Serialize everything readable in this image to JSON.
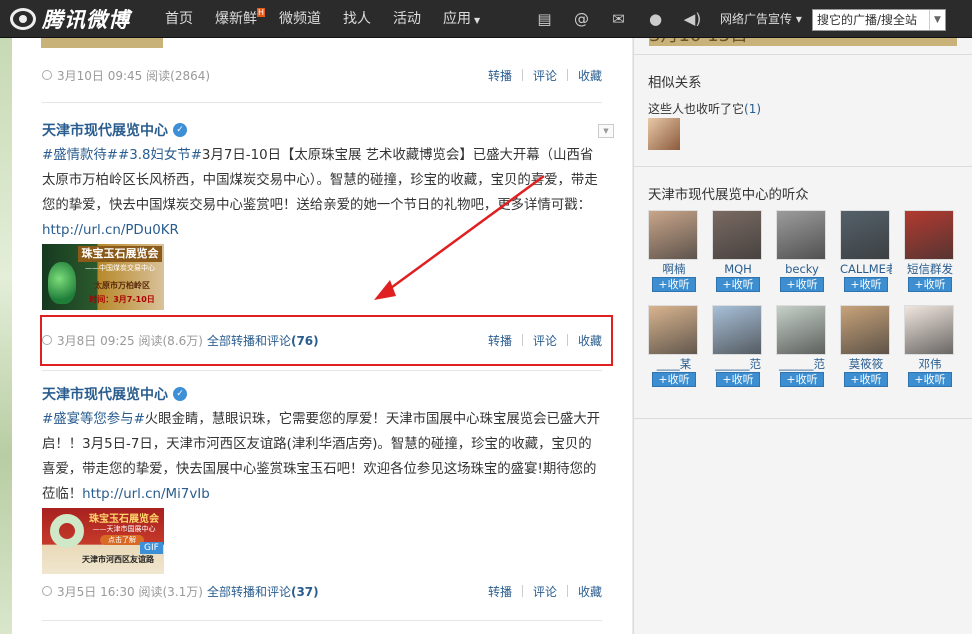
{
  "header": {
    "logo_text": "腾讯微博",
    "nav": [
      {
        "label": "首页"
      },
      {
        "label": "爆新鲜",
        "badge": "H"
      },
      {
        "label": "微频道"
      },
      {
        "label": "找人"
      },
      {
        "label": "活动"
      },
      {
        "label": "应用"
      }
    ],
    "icons": [
      "message-icon",
      "at-icon",
      "mail-icon",
      "user-icon",
      "sound-icon"
    ],
    "ad_link": "网络广告宣传",
    "search_placeholder": "搜它的广播/搜全站"
  },
  "feed": {
    "first_post_actions": {
      "time": "3月10日 09:45",
      "reads": "阅读(2864)"
    },
    "posts": [
      {
        "author": "天津市现代展览中心",
        "tag": "#盛情款待##3.8妇女节#",
        "text": "3月7日-10日【太原珠宝展 艺术收藏博览会】已盛大开幕（山西省太原市万柏岭区长风桥西，中国煤炭交易中心）。智慧的碰撞，珍宝的收藏，宝贝的喜爱，带走您的挚爱，快去中国煤炭交易中心鉴赏吧！送给亲爱的她一个节日的礼物吧，更多详情可戳：",
        "url": "http://url.cn/PDu0KR",
        "image": {
          "title": "珠宝玉石展览会",
          "sub": "——中国煤炭交易中心",
          "place": "太原市万柏岭区",
          "dates": "时间：3月7-10日"
        },
        "time": "3月8日 09:25",
        "reads": "阅读(8.6万)",
        "all_label": "全部转播和评论",
        "count": "(76)"
      },
      {
        "author": "天津市现代展览中心",
        "tag": "#盛宴等您参与#",
        "text": "火眼金睛，慧眼识珠，它需要您的厚爱！天津市国展中心珠宝展览会已盛大开启！！3月5日-7日，天津市河西区友谊路(津利华酒店旁)。智慧的碰撞，珍宝的收藏，宝贝的喜爱，带走您的挚爱，快去国展中心鉴赏珠宝玉石吧！欢迎各位参见这场珠宝的盛宴!期待您的莅临！",
        "url": "http://url.cn/Mi7vIb",
        "image": {
          "title": "珠宝玉石展览会",
          "sub": "——天津市国展中心",
          "button": "点击了解",
          "place": "天津市河西区友谊路",
          "badge": "GIF"
        },
        "time": "3月5日 16:30",
        "reads": "阅读(3.1万)",
        "all_label": "全部转播和评论",
        "count": "(37)"
      }
    ],
    "actions": {
      "repost": "转播",
      "comment": "评论",
      "favorite": "收藏"
    }
  },
  "sidebar": {
    "top_image_text": "3月10 13日",
    "related_title": "相似关系",
    "related_sub": "这些人也收听了它",
    "related_count": "(1)",
    "listeners_title": "天津市现代展览中心的听众",
    "follow_label": "+收听",
    "listeners": [
      {
        "name": "啊楠",
        "color": "#c9a58a"
      },
      {
        "name": "MQH",
        "color": "#7a6a62"
      },
      {
        "name": "becky",
        "color": "#9c9c9c"
      },
      {
        "name": "CALLME老",
        "color": "#54616a"
      },
      {
        "name": "短信群发",
        "color": "#b23a30"
      },
      {
        "name": "____某",
        "color": "#d9b48f"
      },
      {
        "name": "______范",
        "color": "#a8c0d8"
      },
      {
        "name": "______范",
        "color": "#c6d0c8"
      },
      {
        "name": "莫筱筱",
        "color": "#c8a37a"
      },
      {
        "name": "邓伟",
        "color": "#f0e6de"
      }
    ]
  }
}
